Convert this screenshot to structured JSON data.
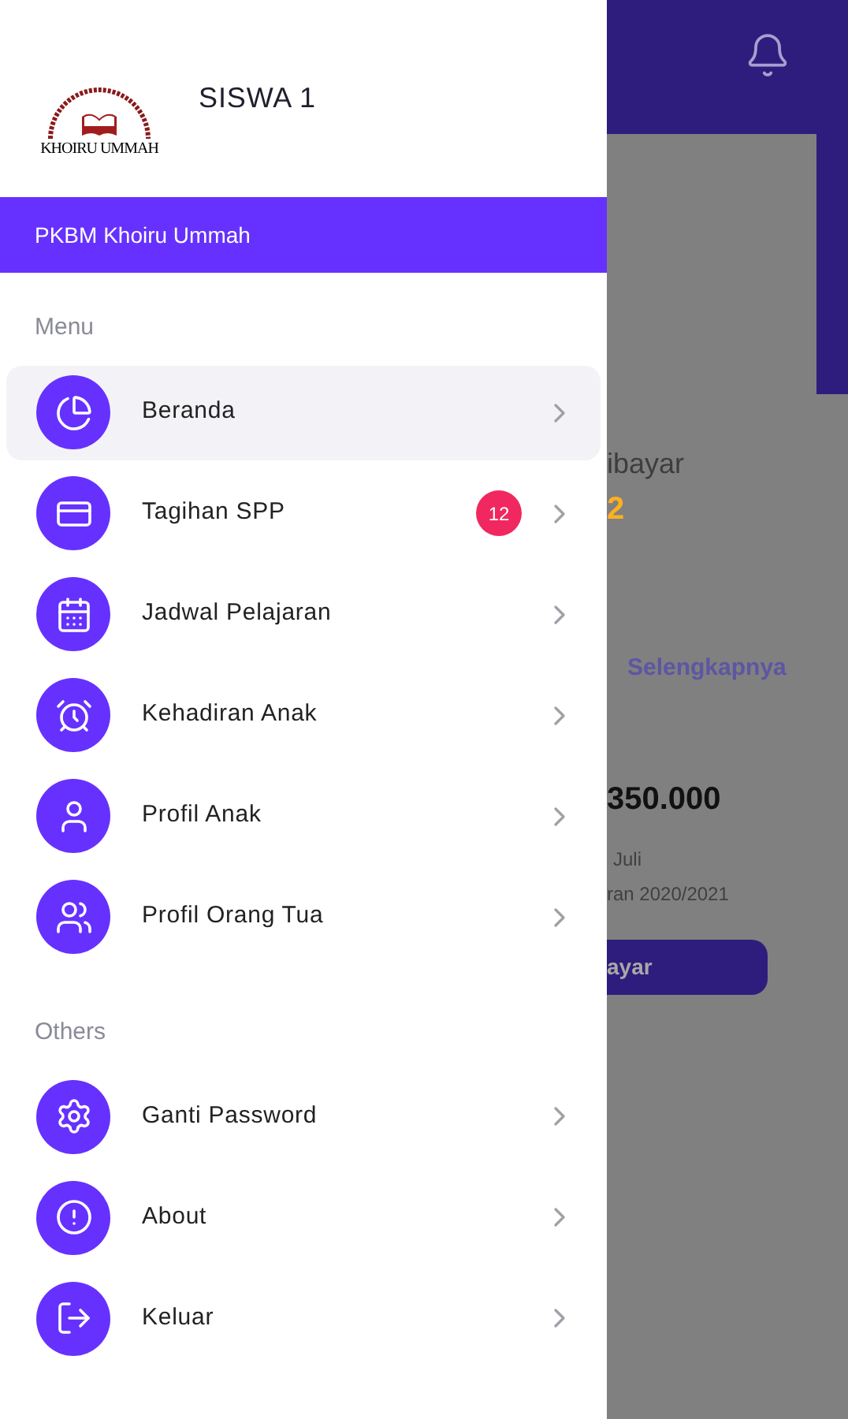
{
  "drawer": {
    "logo_text": "KHOIRU UMMAH",
    "user_name": "SISWA 1",
    "school": "PKBM Khoiru Ummah",
    "sections": [
      {
        "title": "Menu",
        "items": [
          {
            "label": "Beranda",
            "selected": true
          },
          {
            "label": "Tagihan SPP",
            "selected": false,
            "badge": "12"
          },
          {
            "label": "Jadwal Pelajaran",
            "selected": false
          },
          {
            "label": "Kehadiran Anak",
            "selected": false
          },
          {
            "label": "Profil Anak",
            "selected": false
          },
          {
            "label": "Profil Orang Tua",
            "selected": false
          }
        ]
      },
      {
        "title": "Others",
        "items": [
          {
            "label": "Ganti Password",
            "selected": false
          },
          {
            "label": "About",
            "selected": false
          },
          {
            "label": "Keluar",
            "selected": false
          }
        ]
      }
    ]
  },
  "background": {
    "status_label": "ibayar",
    "status_value": "2",
    "link": "Selengkapnya",
    "amount": "350.000",
    "month": "Juli",
    "year": "ran 2020/2021",
    "pay_button": "ayar"
  }
}
